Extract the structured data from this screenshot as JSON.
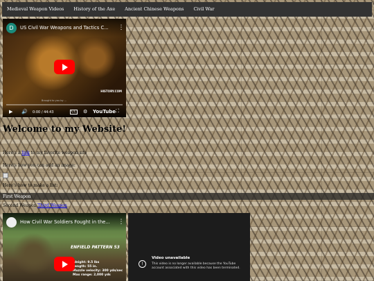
{
  "nav": {
    "items": [
      {
        "label": "Medieval Weapon Videos"
      },
      {
        "label": "History of the Axe"
      },
      {
        "label": "Ancient Chinese Weapons"
      },
      {
        "label": "Civil War"
      }
    ]
  },
  "video1": {
    "channel_initial": "D",
    "title": "US Civil War Weapons and Tactics C...",
    "time": "0:00 / 44:43",
    "watermark": "HISTORY.COM",
    "caption": "Brought to you by ..."
  },
  "main": {
    "heading": "Welcome to my Website!",
    "p1_prefix": "Here's a",
    "p1_link": "link",
    "p1_suffix": "to my favorite weapon site",
    "p2": "Here's how you can add an image:",
    "p3": "Here's how to make a list:",
    "p4": "First Weapon",
    "p5_prefix": "Second Weapon",
    "p5_link": "Third Weapon"
  },
  "video2": {
    "channel_initial": "",
    "title": "How Civil War Soldiers Fought in the...",
    "overlay_title": "ENFIELD PATTERN 53",
    "stats": [
      "Weight: 9.5 lbs",
      "Length: 55 in.",
      "Muzzle velocity: 300 yds/sec",
      "Max range: 2,000 yds"
    ]
  },
  "video3": {
    "title": "Video unavailable",
    "message": "This video is no longer available because the YouTube account associated with this video has been terminated."
  },
  "colors": {
    "nav_bg": "#333333",
    "yt_red": "#ff0000",
    "link": "#0000ee"
  }
}
